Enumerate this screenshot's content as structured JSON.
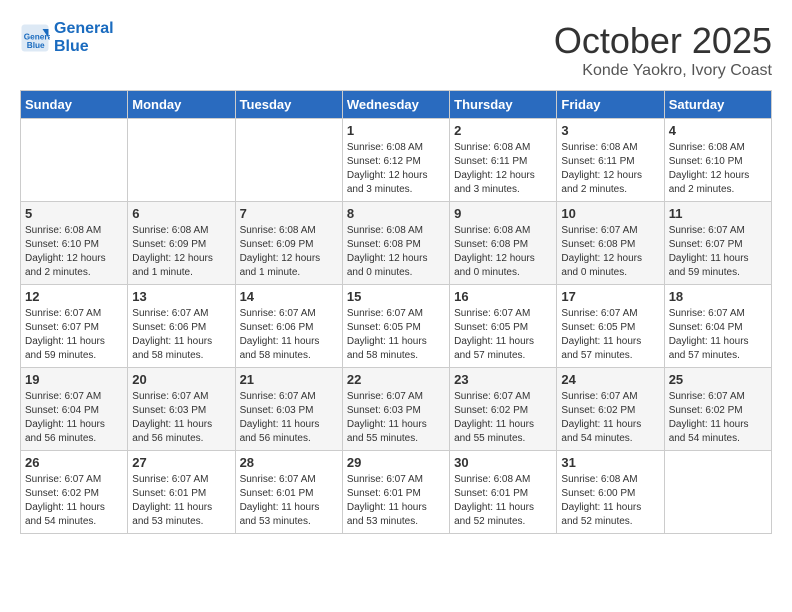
{
  "header": {
    "logo_line1": "General",
    "logo_line2": "Blue",
    "month": "October 2025",
    "location": "Konde Yaokro, Ivory Coast"
  },
  "weekdays": [
    "Sunday",
    "Monday",
    "Tuesday",
    "Wednesday",
    "Thursday",
    "Friday",
    "Saturday"
  ],
  "weeks": [
    [
      null,
      null,
      null,
      {
        "day": "1",
        "sunrise": "6:08 AM",
        "sunset": "6:12 PM",
        "daylight": "12 hours and 3 minutes."
      },
      {
        "day": "2",
        "sunrise": "6:08 AM",
        "sunset": "6:11 PM",
        "daylight": "12 hours and 3 minutes."
      },
      {
        "day": "3",
        "sunrise": "6:08 AM",
        "sunset": "6:11 PM",
        "daylight": "12 hours and 2 minutes."
      },
      {
        "day": "4",
        "sunrise": "6:08 AM",
        "sunset": "6:10 PM",
        "daylight": "12 hours and 2 minutes."
      }
    ],
    [
      {
        "day": "5",
        "sunrise": "6:08 AM",
        "sunset": "6:10 PM",
        "daylight": "12 hours and 2 minutes."
      },
      {
        "day": "6",
        "sunrise": "6:08 AM",
        "sunset": "6:09 PM",
        "daylight": "12 hours and 1 minute."
      },
      {
        "day": "7",
        "sunrise": "6:08 AM",
        "sunset": "6:09 PM",
        "daylight": "12 hours and 1 minute."
      },
      {
        "day": "8",
        "sunrise": "6:08 AM",
        "sunset": "6:08 PM",
        "daylight": "12 hours and 0 minutes."
      },
      {
        "day": "9",
        "sunrise": "6:08 AM",
        "sunset": "6:08 PM",
        "daylight": "12 hours and 0 minutes."
      },
      {
        "day": "10",
        "sunrise": "6:07 AM",
        "sunset": "6:08 PM",
        "daylight": "12 hours and 0 minutes."
      },
      {
        "day": "11",
        "sunrise": "6:07 AM",
        "sunset": "6:07 PM",
        "daylight": "11 hours and 59 minutes."
      }
    ],
    [
      {
        "day": "12",
        "sunrise": "6:07 AM",
        "sunset": "6:07 PM",
        "daylight": "11 hours and 59 minutes."
      },
      {
        "day": "13",
        "sunrise": "6:07 AM",
        "sunset": "6:06 PM",
        "daylight": "11 hours and 58 minutes."
      },
      {
        "day": "14",
        "sunrise": "6:07 AM",
        "sunset": "6:06 PM",
        "daylight": "11 hours and 58 minutes."
      },
      {
        "day": "15",
        "sunrise": "6:07 AM",
        "sunset": "6:05 PM",
        "daylight": "11 hours and 58 minutes."
      },
      {
        "day": "16",
        "sunrise": "6:07 AM",
        "sunset": "6:05 PM",
        "daylight": "11 hours and 57 minutes."
      },
      {
        "day": "17",
        "sunrise": "6:07 AM",
        "sunset": "6:05 PM",
        "daylight": "11 hours and 57 minutes."
      },
      {
        "day": "18",
        "sunrise": "6:07 AM",
        "sunset": "6:04 PM",
        "daylight": "11 hours and 57 minutes."
      }
    ],
    [
      {
        "day": "19",
        "sunrise": "6:07 AM",
        "sunset": "6:04 PM",
        "daylight": "11 hours and 56 minutes."
      },
      {
        "day": "20",
        "sunrise": "6:07 AM",
        "sunset": "6:03 PM",
        "daylight": "11 hours and 56 minutes."
      },
      {
        "day": "21",
        "sunrise": "6:07 AM",
        "sunset": "6:03 PM",
        "daylight": "11 hours and 56 minutes."
      },
      {
        "day": "22",
        "sunrise": "6:07 AM",
        "sunset": "6:03 PM",
        "daylight": "11 hours and 55 minutes."
      },
      {
        "day": "23",
        "sunrise": "6:07 AM",
        "sunset": "6:02 PM",
        "daylight": "11 hours and 55 minutes."
      },
      {
        "day": "24",
        "sunrise": "6:07 AM",
        "sunset": "6:02 PM",
        "daylight": "11 hours and 54 minutes."
      },
      {
        "day": "25",
        "sunrise": "6:07 AM",
        "sunset": "6:02 PM",
        "daylight": "11 hours and 54 minutes."
      }
    ],
    [
      {
        "day": "26",
        "sunrise": "6:07 AM",
        "sunset": "6:02 PM",
        "daylight": "11 hours and 54 minutes."
      },
      {
        "day": "27",
        "sunrise": "6:07 AM",
        "sunset": "6:01 PM",
        "daylight": "11 hours and 53 minutes."
      },
      {
        "day": "28",
        "sunrise": "6:07 AM",
        "sunset": "6:01 PM",
        "daylight": "11 hours and 53 minutes."
      },
      {
        "day": "29",
        "sunrise": "6:07 AM",
        "sunset": "6:01 PM",
        "daylight": "11 hours and 53 minutes."
      },
      {
        "day": "30",
        "sunrise": "6:08 AM",
        "sunset": "6:01 PM",
        "daylight": "11 hours and 52 minutes."
      },
      {
        "day": "31",
        "sunrise": "6:08 AM",
        "sunset": "6:00 PM",
        "daylight": "11 hours and 52 minutes."
      },
      null
    ]
  ],
  "labels": {
    "sunrise": "Sunrise:",
    "sunset": "Sunset:",
    "daylight": "Daylight:"
  }
}
